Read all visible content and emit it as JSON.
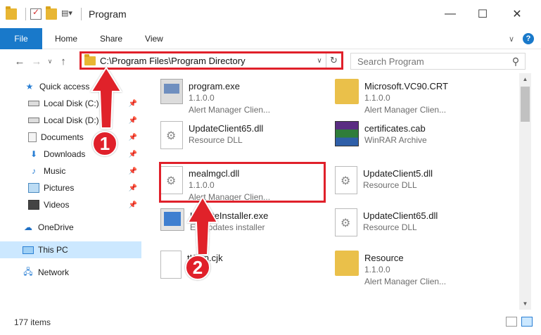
{
  "window": {
    "title": "Program",
    "minimize": "—",
    "maximize": "☐",
    "close": "✕"
  },
  "ribbon": {
    "file": "File",
    "tabs": [
      "Home",
      "Share",
      "View"
    ],
    "expand": "∨",
    "help": "?"
  },
  "nav": {
    "back": "←",
    "forward": "→",
    "recent": "∨",
    "up": "↑"
  },
  "address": {
    "path": "C:\\Program Files\\Program Directory",
    "dropdown": "∨",
    "refresh": "↻"
  },
  "search": {
    "placeholder": "Search Program",
    "icon": "search-icon"
  },
  "sidebar": {
    "items": [
      {
        "label": "Quick access",
        "icon": "star-icon"
      },
      {
        "label": "Local Disk (C:)",
        "icon": "disk-icon",
        "pinned": true
      },
      {
        "label": "Local Disk (D:)",
        "icon": "disk-icon",
        "pinned": true
      },
      {
        "label": "Documents",
        "icon": "documents-icon",
        "pinned": true
      },
      {
        "label": "Downloads",
        "icon": "download-icon",
        "pinned": true
      },
      {
        "label": "Music",
        "icon": "music-icon",
        "pinned": true
      },
      {
        "label": "Pictures",
        "icon": "pictures-icon",
        "pinned": true
      },
      {
        "label": "Videos",
        "icon": "videos-icon",
        "pinned": true
      },
      {
        "label": "OneDrive",
        "icon": "cloud-icon"
      },
      {
        "label": "This PC",
        "icon": "pc-icon",
        "selected": true
      },
      {
        "label": "Network",
        "icon": "network-icon"
      }
    ]
  },
  "files": [
    {
      "name": "program.exe",
      "line2": "1.1.0.0",
      "line3": "Alert Manager Clien...",
      "icon": "exe-icon"
    },
    {
      "name": "Microsoft.VC90.CRT",
      "line2": "1.1.0.0",
      "line3": "Alert Manager Clien...",
      "icon": "folder-icon"
    },
    {
      "name": "UpdateClient65.dll",
      "line2": "Resource DLL",
      "line3": "",
      "icon": "dll-icon"
    },
    {
      "name": "certificates.cab",
      "line2": "WinRAR Archive",
      "line3": "",
      "icon": "rar-icon"
    },
    {
      "name": "mealmgcl.dll",
      "line2": "1.1.0.0",
      "line3": "Alert Manager Clien...",
      "icon": "dll-icon"
    },
    {
      "name": "UpdateClient5.dll",
      "line2": "Resource DLL",
      "line3": "",
      "icon": "dll-icon"
    },
    {
      "name": "UpdateInstaller.exe",
      "line2": "EY updates installer",
      "line3": "",
      "icon": "installer-icon"
    },
    {
      "name": "UpdateClient65.dll",
      "line2": "Resource DLL",
      "line3": "",
      "icon": "dll-icon"
    },
    {
      "name": "tKorn.cjk",
      "line2": "le",
      "line3": "",
      "icon": "file-icon"
    },
    {
      "name": "Resource",
      "line2": "1.1.0.0",
      "line3": "Alert Manager Clien...",
      "icon": "folder-icon"
    }
  ],
  "callouts": {
    "one": "1",
    "two": "2"
  },
  "status": {
    "count": "177 items"
  },
  "colors": {
    "accent": "#1979ca",
    "highlight": "#e0202a",
    "selected": "#cce8ff"
  }
}
